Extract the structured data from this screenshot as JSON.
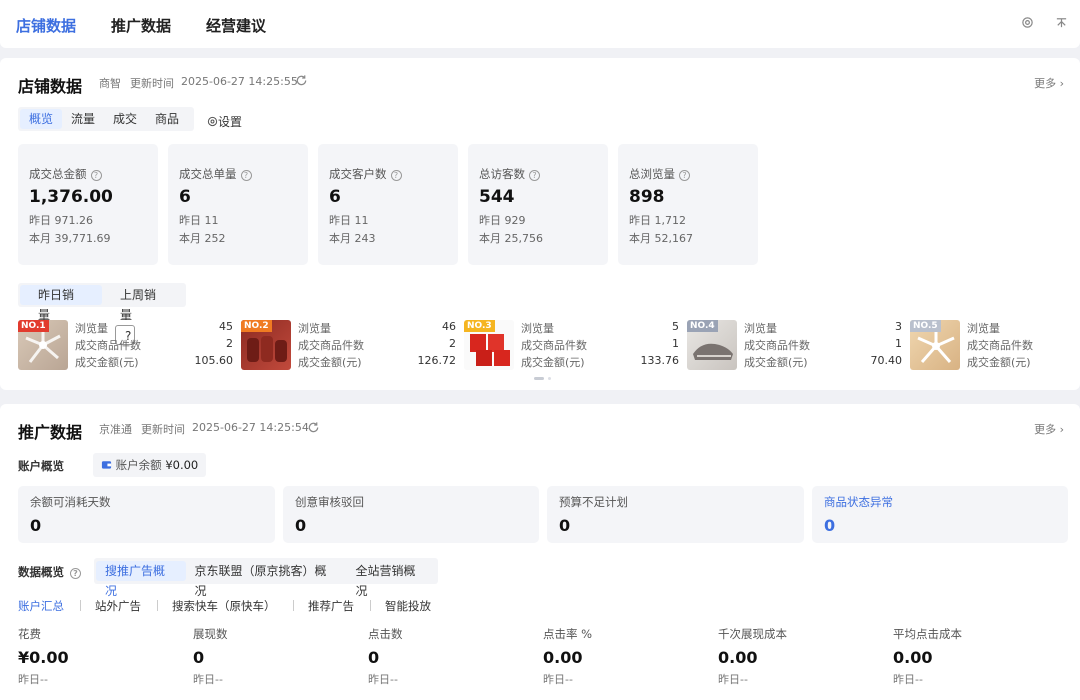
{
  "topnav": {
    "tabs": [
      {
        "label": "店铺数据"
      },
      {
        "label": "推广数据"
      },
      {
        "label": "经营建议"
      }
    ],
    "icons": [
      "settings-icon",
      "pin-icon"
    ]
  },
  "store": {
    "title": "店铺数据",
    "source": "商智",
    "update_label": "更新时间",
    "update_time": "2025-06-27 14:25:55",
    "more": "更多",
    "tabs": [
      {
        "label": "概览"
      },
      {
        "label": "流量"
      },
      {
        "label": "成交"
      },
      {
        "label": "商品"
      }
    ],
    "settings_label": "设置",
    "cards": [
      {
        "label": "成交总金额",
        "value": "1,376.00",
        "yesterday": "昨日 971.26",
        "month": "本月 39,771.69"
      },
      {
        "label": "成交总单量",
        "value": "6",
        "yesterday": "昨日 11",
        "month": "本月 252"
      },
      {
        "label": "成交客户数",
        "value": "6",
        "yesterday": "昨日 11",
        "month": "本月 243"
      },
      {
        "label": "总访客数",
        "value": "544",
        "yesterday": "昨日 929",
        "month": "本月 25,756"
      },
      {
        "label": "总浏览量",
        "value": "898",
        "yesterday": "昨日 1,712",
        "month": "本月 52,167"
      }
    ],
    "sales_tabs": [
      {
        "label": "昨日销量"
      },
      {
        "label": "上周销量"
      }
    ],
    "rank_labels": {
      "views": "浏览量",
      "items": "成交商品件数",
      "amount": "成交金额(元)"
    },
    "ranks": [
      {
        "badge": "NO.1",
        "views": "45",
        "items": "2",
        "amount": "105.60",
        "color": "#e23b2e"
      },
      {
        "badge": "NO.2",
        "views": "46",
        "items": "2",
        "amount": "126.72",
        "color": "#f07b22"
      },
      {
        "badge": "NO.3",
        "views": "5",
        "items": "1",
        "amount": "133.76",
        "color": "#f5b521"
      },
      {
        "badge": "NO.4",
        "views": "3",
        "items": "1",
        "amount": "70.40",
        "color": "#9aa3b5"
      },
      {
        "badge": "NO.5",
        "views": "",
        "items": "",
        "amount": "",
        "color": "#b9c0cd"
      }
    ]
  },
  "promo": {
    "title": "推广数据",
    "source": "京准通",
    "update_label": "更新时间",
    "update_time": "2025-06-27 14:25:54",
    "more": "更多",
    "account_overview": "账户概览",
    "balance_label": "账户余额",
    "balance_value": "¥0.00",
    "cards": [
      {
        "label": "余额可消耗天数",
        "value": "0"
      },
      {
        "label": "创意审核驳回",
        "value": "0"
      },
      {
        "label": "预算不足计划",
        "value": "0"
      },
      {
        "label": "商品状态异常",
        "value": "0"
      }
    ],
    "data_overview": "数据概览",
    "overview_tabs": [
      {
        "label": "搜推广告概况"
      },
      {
        "label": "京东联盟（原京挑客）概况"
      },
      {
        "label": "全站营销概况"
      }
    ],
    "sub_tabs": [
      {
        "label": "账户汇总"
      },
      {
        "label": "站外广告"
      },
      {
        "label": "搜索快车（原快车）"
      },
      {
        "label": "推荐广告"
      },
      {
        "label": "智能投放"
      }
    ],
    "metrics": [
      {
        "label": "花费",
        "value": "¥0.00",
        "sub": "昨日--"
      },
      {
        "label": "展现数",
        "value": "0",
        "sub": "昨日--"
      },
      {
        "label": "点击数",
        "value": "0",
        "sub": "昨日--"
      },
      {
        "label": "点击率 %",
        "value": "0.00",
        "sub": "昨日--"
      },
      {
        "label": "千次展现成本",
        "value": "0.00",
        "sub": "昨日--"
      },
      {
        "label": "平均点击成本",
        "value": "0.00",
        "sub": "昨日--"
      }
    ]
  },
  "colors": {
    "accent": "#3d6fe0",
    "card_bg": "#f4f5f8",
    "page_bg": "#f0f1f5"
  }
}
